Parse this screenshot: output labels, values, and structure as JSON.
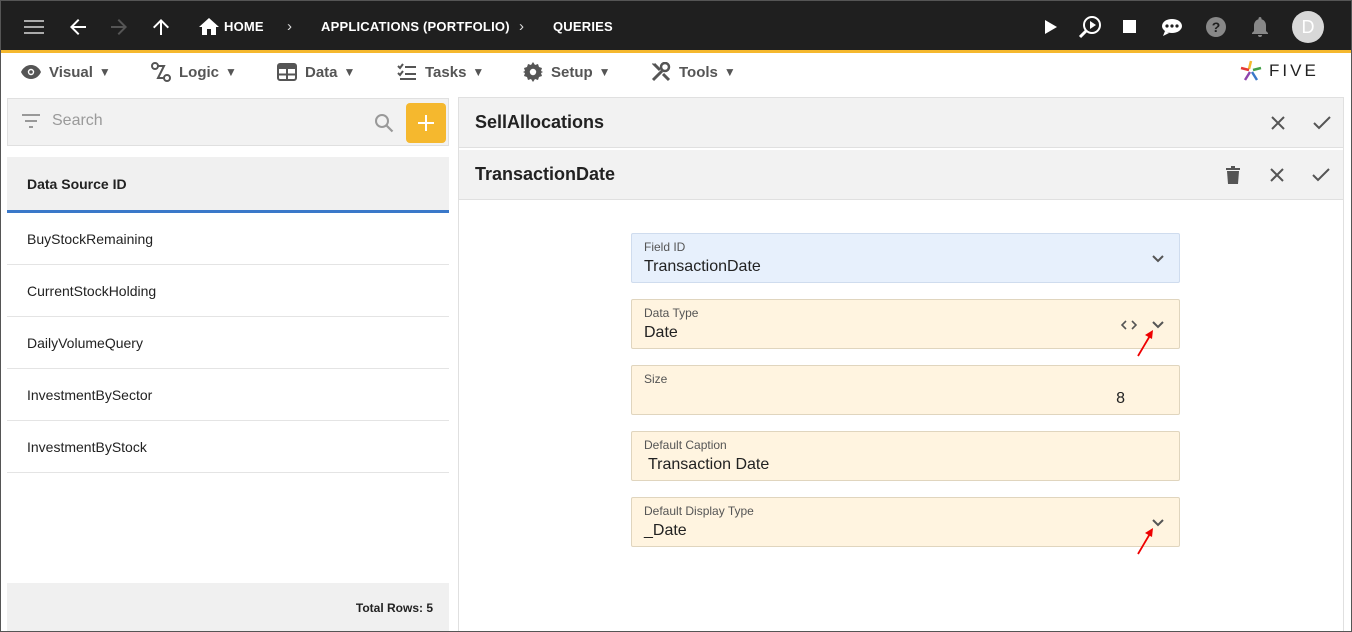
{
  "topbar": {
    "breadcrumb": {
      "home": "HOME",
      "applications": "APPLICATIONS (PORTFOLIO)",
      "queries": "QUERIES"
    },
    "avatar_initial": "D",
    "accent_color": "#f5b82e"
  },
  "menubar": {
    "items": [
      {
        "label": "Visual",
        "icon": "eye-icon"
      },
      {
        "label": "Logic",
        "icon": "logic-icon"
      },
      {
        "label": "Data",
        "icon": "table-icon"
      },
      {
        "label": "Tasks",
        "icon": "tasks-icon"
      },
      {
        "label": "Setup",
        "icon": "gear-icon"
      },
      {
        "label": "Tools",
        "icon": "tools-icon"
      }
    ],
    "caret": "▼",
    "logo_text": "FIVE"
  },
  "sidebar": {
    "search_placeholder": "Search",
    "column_header": "Data Source ID",
    "rows": [
      "BuyStockRemaining",
      "CurrentStockHolding",
      "DailyVolumeQuery",
      "InvestmentBySector",
      "InvestmentByStock"
    ],
    "footer": "Total Rows: 5"
  },
  "main": {
    "header_title": "SellAllocations",
    "subheader_title": "TransactionDate",
    "fields": [
      {
        "label": "Field ID",
        "value": "TransactionDate"
      },
      {
        "label": "Data Type",
        "value": "Date"
      },
      {
        "label": "Size",
        "value": "8"
      },
      {
        "label": "Default Caption",
        "value": "Transaction Date"
      },
      {
        "label": "Default Display Type",
        "value": "_Date"
      }
    ]
  }
}
